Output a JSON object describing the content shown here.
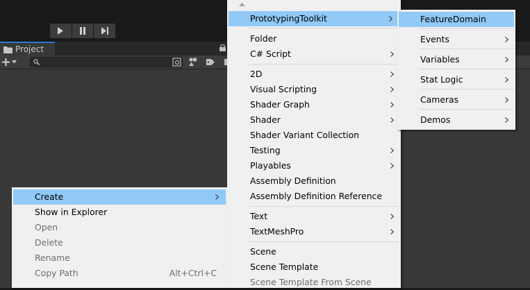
{
  "toolbar": {
    "play_icon": "play-icon",
    "pause_icon": "pause-icon",
    "step_icon": "step-icon"
  },
  "project": {
    "tab_label": "Project",
    "tab_icon": "folder-icon",
    "search_value": "",
    "add_icon": "plus-icon"
  },
  "context_menu": {
    "items": [
      {
        "label": "Create",
        "submenu": true,
        "highlighted": true
      },
      {
        "label": "Show in Explorer"
      },
      {
        "label": "Open",
        "disabled": true
      },
      {
        "label": "Delete",
        "disabled": true
      },
      {
        "label": "Rename",
        "disabled": true
      },
      {
        "label": "Copy Path",
        "disabled": true,
        "shortcut": "Alt+Ctrl+C"
      }
    ]
  },
  "create_menu": {
    "items": [
      {
        "label": "PrototypingToolkit",
        "submenu": true,
        "highlighted": true
      },
      {
        "label": "Folder"
      },
      {
        "label": "C# Script",
        "submenu": true
      },
      {
        "label": "2D",
        "submenu": true
      },
      {
        "label": "Visual Scripting",
        "submenu": true
      },
      {
        "label": "Shader Graph",
        "submenu": true
      },
      {
        "label": "Shader",
        "submenu": true
      },
      {
        "label": "Shader Variant Collection"
      },
      {
        "label": "Testing",
        "submenu": true
      },
      {
        "label": "Playables",
        "submenu": true
      },
      {
        "label": "Assembly Definition"
      },
      {
        "label": "Assembly Definition Reference"
      },
      {
        "label": "Text",
        "submenu": true
      },
      {
        "label": "TextMeshPro",
        "submenu": true
      },
      {
        "label": "Scene"
      },
      {
        "label": "Scene Template"
      },
      {
        "label": "Scene Template From Scene",
        "disabled": true
      }
    ]
  },
  "prototyping_menu": {
    "items": [
      {
        "label": "FeatureDomain",
        "highlighted": true
      },
      {
        "label": "Events",
        "submenu": true
      },
      {
        "label": "Variables",
        "submenu": true
      },
      {
        "label": "Stat Logic",
        "submenu": true
      },
      {
        "label": "Cameras",
        "submenu": true
      },
      {
        "label": "Demos",
        "submenu": true
      }
    ]
  },
  "colors": {
    "menu_bg": "#f0f0f0",
    "highlight": "#91c9f7",
    "editor_dark": "#191919",
    "panel_bg": "#383838"
  }
}
